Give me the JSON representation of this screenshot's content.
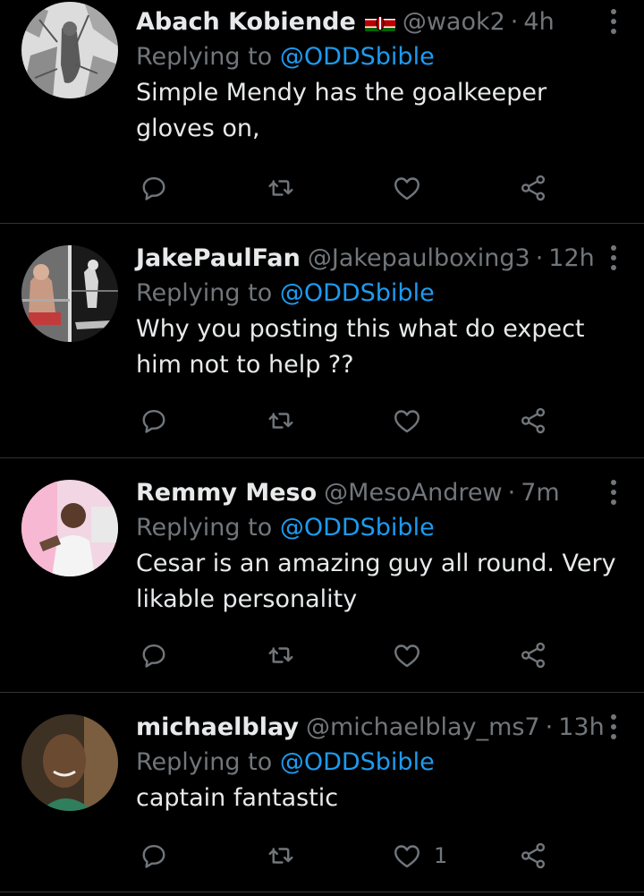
{
  "colors": {
    "background": "#000000",
    "text": "#e7e9ea",
    "muted": "#71767b",
    "link": "#1d9bf0",
    "divider": "#2f3336"
  },
  "icons": {
    "reply": "comment-bubble-icon",
    "retweet": "retweet-icon",
    "like": "heart-icon",
    "share": "share-icon",
    "more": "more-vertical-icon",
    "flag": "kenya-flag-emoji"
  },
  "tweets": [
    {
      "name": "Abach Kobiende",
      "has_flag": true,
      "handle": "@waok2",
      "dot": "·",
      "time": "4h",
      "replying_prefix": "Replying to",
      "replying_to": "@ODDSbible",
      "text": "Simple Mendy has the goalkeeper gloves on,",
      "like_count": ""
    },
    {
      "name": "JakePaulFan",
      "has_flag": false,
      "handle": "@Jakepaulboxing3",
      "dot": "·",
      "time": "12h",
      "replying_prefix": "Replying to",
      "replying_to": "@ODDSbible",
      "text": "Why you posting this what do expect him not to help ??",
      "like_count": ""
    },
    {
      "name": "Remmy Meso",
      "has_flag": false,
      "handle": "@MesoAndrew",
      "dot": "·",
      "time": "7m",
      "replying_prefix": "Replying to",
      "replying_to": "@ODDSbible",
      "text": "Cesar is an amazing guy all round. Very likable personality",
      "like_count": ""
    },
    {
      "name": "michaelblay",
      "has_flag": false,
      "handle": "@michaelblay_ms7",
      "dot": "·",
      "time": "13h",
      "replying_prefix": "Replying to",
      "replying_to": "@ODDSbible",
      "text": "captain fantastic",
      "like_count": "1"
    }
  ]
}
